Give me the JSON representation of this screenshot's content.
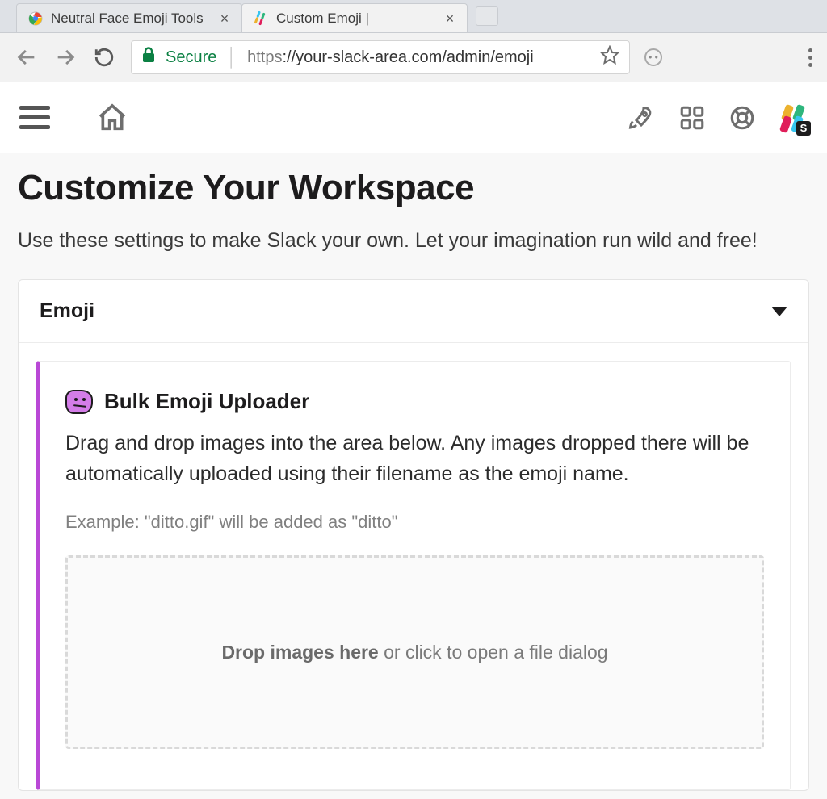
{
  "browser": {
    "tabs": [
      {
        "title": "Neutral Face Emoji Tools",
        "active": false
      },
      {
        "title": "Custom Emoji |",
        "active": true
      }
    ],
    "secure_label": "Secure",
    "url_scheme": "https",
    "url_rest": "://your-slack-area.com/admin/emoji"
  },
  "page": {
    "heading": "Customize Your Workspace",
    "lead": "Use these settings to make Slack your own. Let your imagination run wild and free!",
    "panel_title": "Emoji",
    "uploader": {
      "title": "Bulk Emoji Uploader",
      "description": "Drag and drop images into the area below. Any images dropped there will be automatically uploaded using their filename as the emoji name.",
      "example": "Example: \"ditto.gif\" will be added as \"ditto\"",
      "drop_bold": "Drop images here",
      "drop_rest": " or click to open a file dialog"
    }
  }
}
